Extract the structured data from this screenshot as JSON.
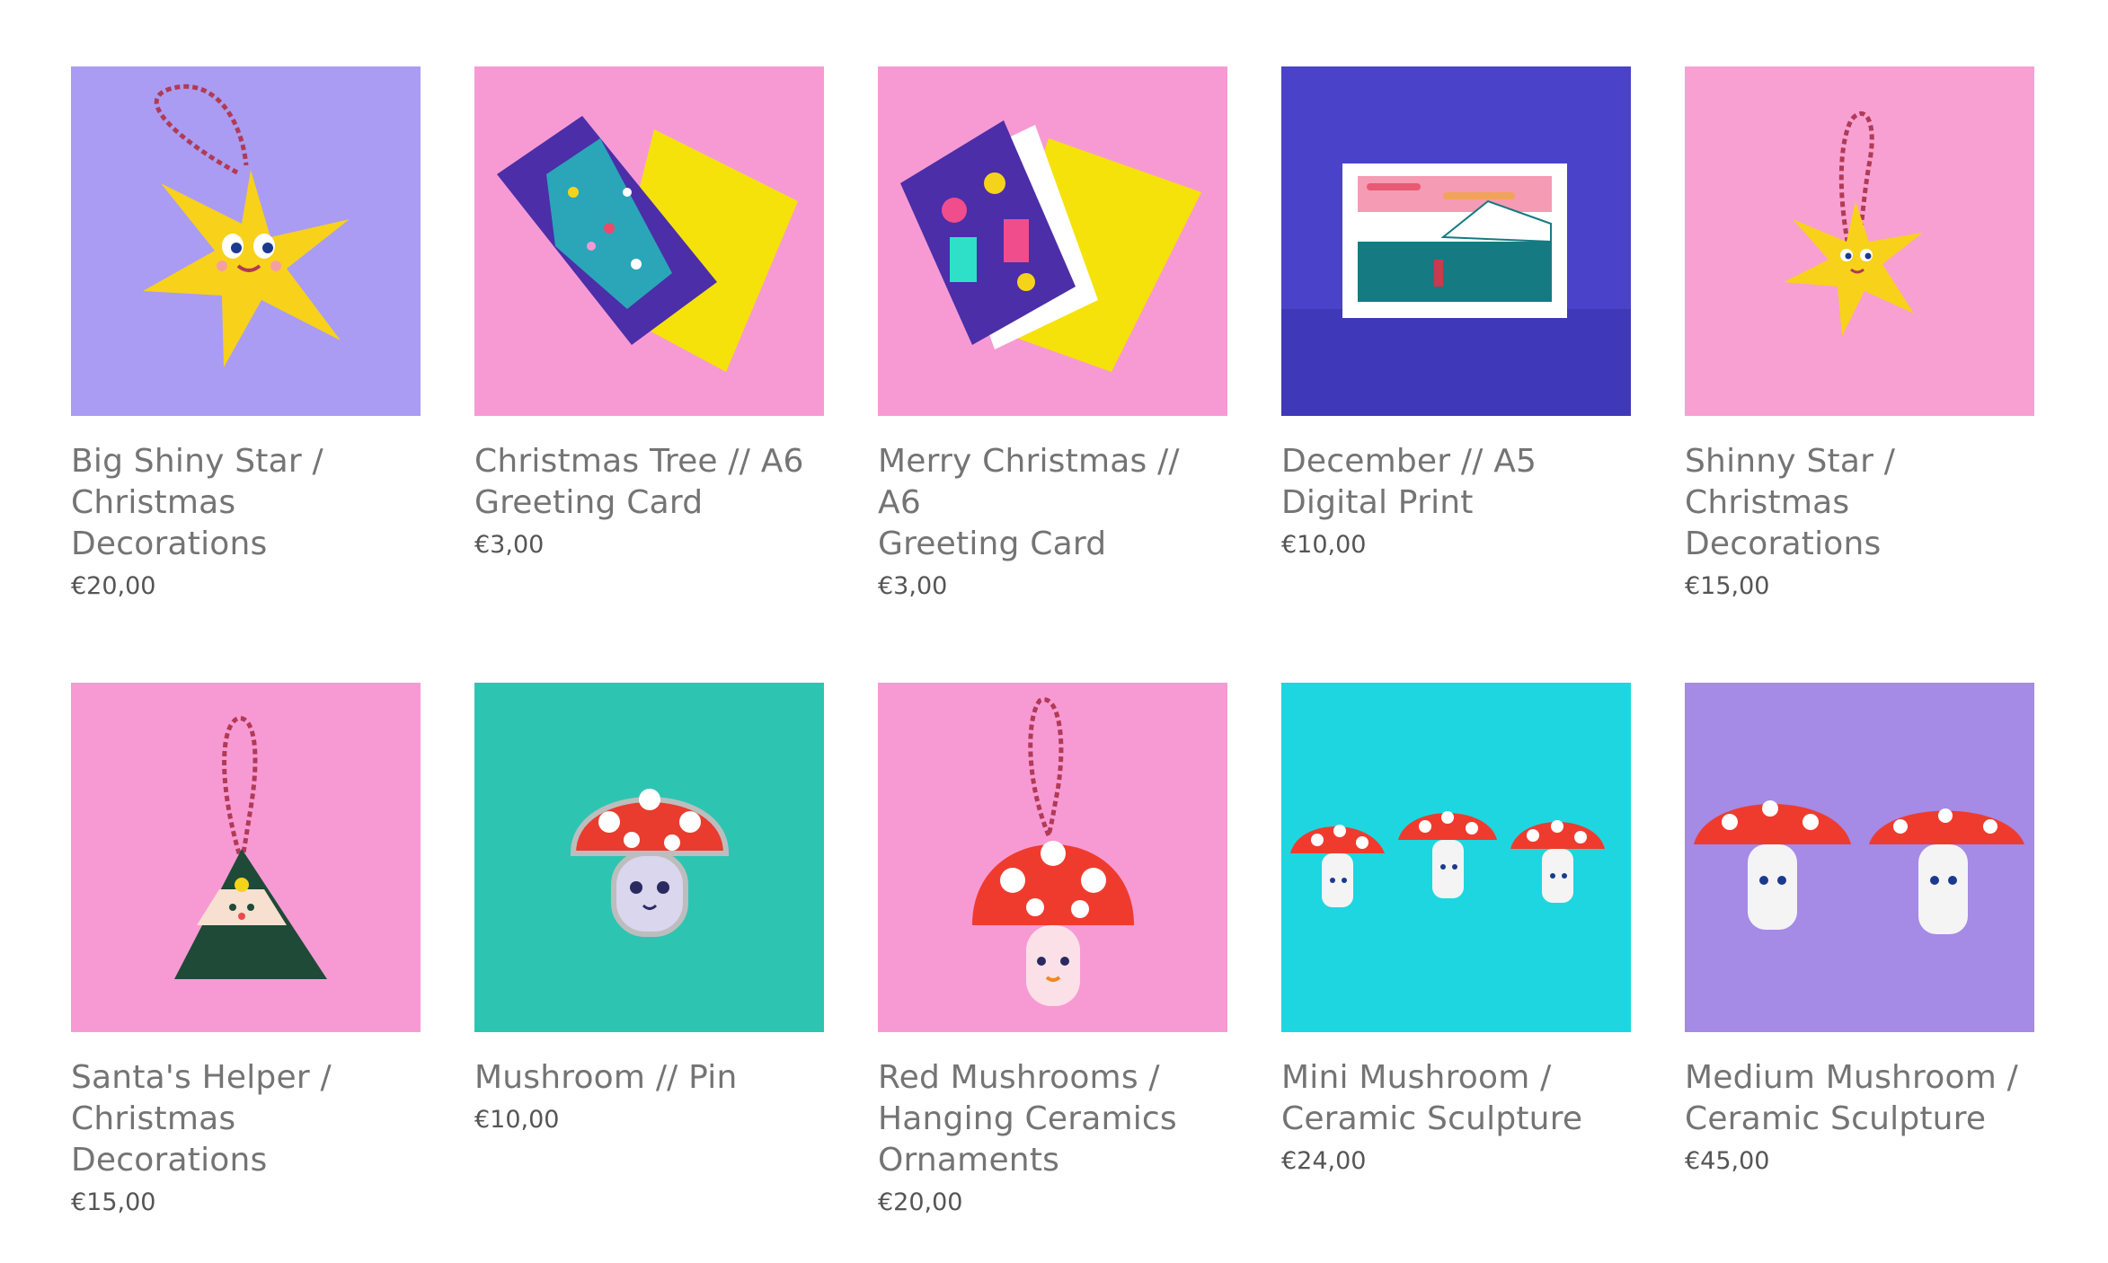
{
  "products": [
    {
      "title_lines": [
        "Big Shiny Star /",
        "Christmas",
        "Decorations"
      ],
      "price": "€20,00",
      "bg": "#a99cf2",
      "art": "star-ornament-icon"
    },
    {
      "title_lines": [
        "Christmas Tree // A6",
        "Greeting Card"
      ],
      "price": "€3,00",
      "bg": "#f79ad4",
      "art": "tree-card-icon"
    },
    {
      "title_lines": [
        "Merry Christmas // A6",
        "Greeting Card"
      ],
      "price": "€3,00",
      "bg": "#f79ad4",
      "art": "merry-card-icon"
    },
    {
      "title_lines": [
        "December // A5",
        "Digital Print"
      ],
      "price": "€10,00",
      "bg": "#4a43c9",
      "art": "print-icon"
    },
    {
      "title_lines": [
        "Shinny Star /",
        "Christmas",
        "Decorations"
      ],
      "price": "€15,00",
      "bg": "#f8a0d2",
      "art": "small-star-ornament-icon"
    },
    {
      "title_lines": [
        "Santa's Helper /",
        "Christmas",
        "Decorations"
      ],
      "price": "€15,00",
      "bg": "#f79ad4",
      "art": "elf-ornament-icon"
    },
    {
      "title_lines": [
        "Mushroom // Pin"
      ],
      "price": "€10,00",
      "bg": "#2ec4b2",
      "art": "mushroom-pin-icon"
    },
    {
      "title_lines": [
        "Red Mushrooms /",
        "Hanging Ceramics",
        "Ornaments"
      ],
      "price": "€20,00",
      "bg": "#f79ad4",
      "art": "mushroom-ornament-icon"
    },
    {
      "title_lines": [
        "Mini Mushroom /",
        "Ceramic Sculpture"
      ],
      "price": "€24,00",
      "bg": "#1ed6e0",
      "art": "mini-mushrooms-icon"
    },
    {
      "title_lines": [
        "Medium Mushroom /",
        "Ceramic Sculpture"
      ],
      "price": "€45,00",
      "bg": "#a58ae6",
      "art": "medium-mushrooms-icon"
    }
  ]
}
